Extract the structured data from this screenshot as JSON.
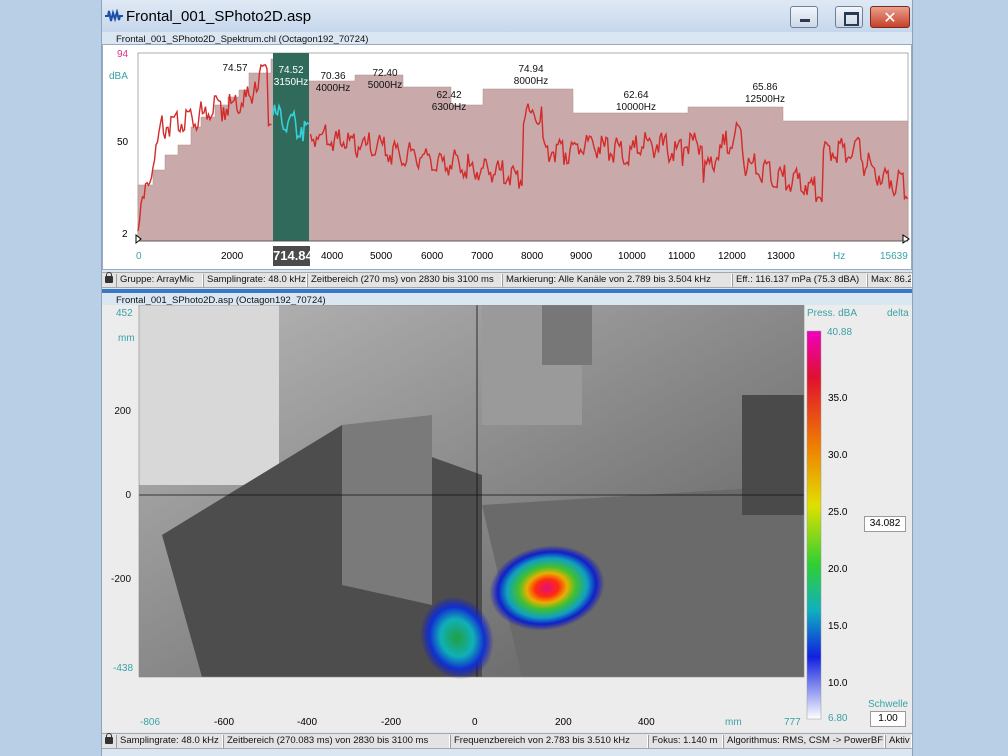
{
  "window": {
    "title": "Frontal_001_SPhoto2D.asp",
    "close_glyph": "✕"
  },
  "spectrum": {
    "subtitle": "Frontal_001_SPhoto2D_Spektrum.chl (Octagon192_70724)",
    "y_max_label": "94",
    "y_unit": "dBA",
    "y_mid_label": "50",
    "y_min_label": "2",
    "x_ticks": [
      "0",
      "2000",
      "4000",
      "5000",
      "6000",
      "7000",
      "8000",
      "9000",
      "10000",
      "11000",
      "12000",
      "13000"
    ],
    "x_unit": "Hz",
    "x_max_label": "15639",
    "cursor_value": "714.84",
    "band_labels": [
      {
        "level": "74.57",
        "freq": ""
      },
      {
        "level": "74.52",
        "freq": "3150Hz"
      },
      {
        "level": "70.36",
        "freq": "4000Hz"
      },
      {
        "level": "72.40",
        "freq": "5000Hz"
      },
      {
        "level": "62.42",
        "freq": "6300Hz"
      },
      {
        "level": "74.94",
        "freq": "8000Hz"
      },
      {
        "level": "62.64",
        "freq": "10000Hz"
      },
      {
        "level": "65.86",
        "freq": "12500Hz"
      }
    ],
    "colors": {
      "bars": "#c9a9a9",
      "curve": "#d42a2a",
      "highlight": "#2f6a5a",
      "highlight_curve": "#36d0d8"
    }
  },
  "status_top": {
    "gruppe": "Gruppe: ArrayMic",
    "samplingrate": "Samplingrate: 48.0 kHz",
    "zeitbereich": "Zeitbereich (270 ms) von 2830 bis 3100 ms",
    "markierung": "Markierung: Alle Kanäle von 2.789 bis 3.504 kHz",
    "eff": "Eff.: 116.137 mPa (75.3 dBA)",
    "max": "Max: 86.2"
  },
  "map": {
    "subtitle": "Frontal_001_SPhoto2D.asp (Octagon192_70724)",
    "y_max_label": "452",
    "y_unit": "mm",
    "y_ticks": [
      "200",
      "0",
      "-200"
    ],
    "y_min_label": "-438",
    "x_min_label": "-806",
    "x_ticks": [
      "-600",
      "-400",
      "-200",
      "0",
      "200",
      "400"
    ],
    "x_unit": "mm",
    "x_max_label": "777"
  },
  "colorbar": {
    "title": "Press. dBA",
    "delta_label": "delta",
    "max_label": "40.88",
    "ticks": [
      "35.0",
      "30.0",
      "25.0",
      "20.0",
      "15.0",
      "10.0"
    ],
    "min_label": "6.80",
    "current_value": "34.082",
    "threshold_label": "Schwelle",
    "threshold_value": "1.00"
  },
  "status_bottom": {
    "samplingrate": "Samplingrate: 48.0 kHz",
    "zeitbereich": "Zeitbereich (270.083 ms) von 2830 bis 3100 ms",
    "frequenz": "Frequenzbereich von 2.783 bis 3.510 kHz",
    "fokus": "Fokus: 1.140 m",
    "algorithmus": "Algorithmus: RMS, CSM -> PowerBF",
    "aktiv": "Aktiv"
  }
}
